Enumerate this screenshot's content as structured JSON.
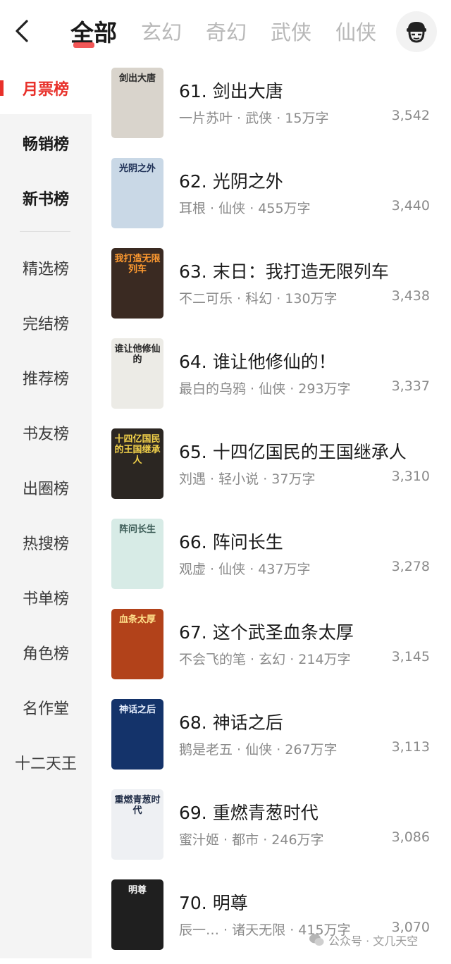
{
  "header": {
    "tabs": [
      "全部",
      "玄幻",
      "奇幻",
      "武侠",
      "仙侠"
    ]
  },
  "sidebar": {
    "items": [
      "月票榜",
      "畅销榜",
      "新书榜",
      "精选榜",
      "完结榜",
      "推荐榜",
      "书友榜",
      "出圈榜",
      "热搜榜",
      "书单榜",
      "角色榜",
      "名作堂",
      "十二天王"
    ]
  },
  "books": [
    {
      "title": "61. 剑出大唐",
      "author": "一片苏叶",
      "genre": "武侠",
      "words": "15万字",
      "count": "3,542",
      "cover_text": "剑出大唐",
      "cover_color": "#d9d4cc",
      "cover_text_color": "#2a2a2a"
    },
    {
      "title": "62. 光阴之外",
      "author": "耳根",
      "genre": "仙侠",
      "words": "455万字",
      "count": "3,440",
      "cover_text": "光阴之外",
      "cover_color": "#c9d8e6",
      "cover_text_color": "#1d2f55"
    },
    {
      "title": "63. 末日：我打造无限列车",
      "author": "不二可乐",
      "genre": "科幻",
      "words": "130万字",
      "count": "3,438",
      "cover_text": "我打造无限列车",
      "cover_color": "#3a2a22",
      "cover_text_color": "#ff9a30"
    },
    {
      "title": "64. 谁让他修仙的！",
      "author": "最白的乌鸦",
      "genre": "仙侠",
      "words": "293万字",
      "count": "3,337",
      "cover_text": "谁让他修仙的",
      "cover_color": "#ecebe6",
      "cover_text_color": "#222222"
    },
    {
      "title": "65. 十四亿国民的王国继承人",
      "author": "刘遇",
      "genre": "轻小说",
      "words": "37万字",
      "count": "3,310",
      "cover_text": "十四亿国民的王国继承人",
      "cover_color": "#2b2622",
      "cover_text_color": "#f3d24a"
    },
    {
      "title": "66. 阵问长生",
      "author": "观虚",
      "genre": "仙侠",
      "words": "437万字",
      "count": "3,278",
      "cover_text": "阵问长生",
      "cover_color": "#d7ebe6",
      "cover_text_color": "#3a5a55"
    },
    {
      "title": "67. 这个武圣血条太厚",
      "author": "不会飞的笔",
      "genre": "玄幻",
      "words": "214万字",
      "count": "3,145",
      "cover_text": "血条太厚",
      "cover_color": "#b2421a",
      "cover_text_color": "#ffe08a"
    },
    {
      "title": "68. 神话之后",
      "author": "鹅是老五",
      "genre": "仙侠",
      "words": "267万字",
      "count": "3,113",
      "cover_text": "神话之后",
      "cover_color": "#14336a",
      "cover_text_color": "#e8f0ff"
    },
    {
      "title": "69. 重燃青葱时代",
      "author": "蜜汁姬",
      "genre": "都市",
      "words": "246万字",
      "count": "3,086",
      "cover_text": "重燃青葱时代",
      "cover_color": "#eef0f3",
      "cover_text_color": "#1d2a44"
    },
    {
      "title": "70. 明尊",
      "author": "辰一…",
      "genre": "诸天无限",
      "words": "415万字",
      "count": "3,070",
      "cover_text": "明尊",
      "cover_color": "#1f1f1f",
      "cover_text_color": "#f2f2f2"
    }
  ],
  "watermark": "公众号 · 文几天空",
  "colors": {
    "accent": "#e8302a",
    "sidebar_bg": "#f4f4f4"
  }
}
